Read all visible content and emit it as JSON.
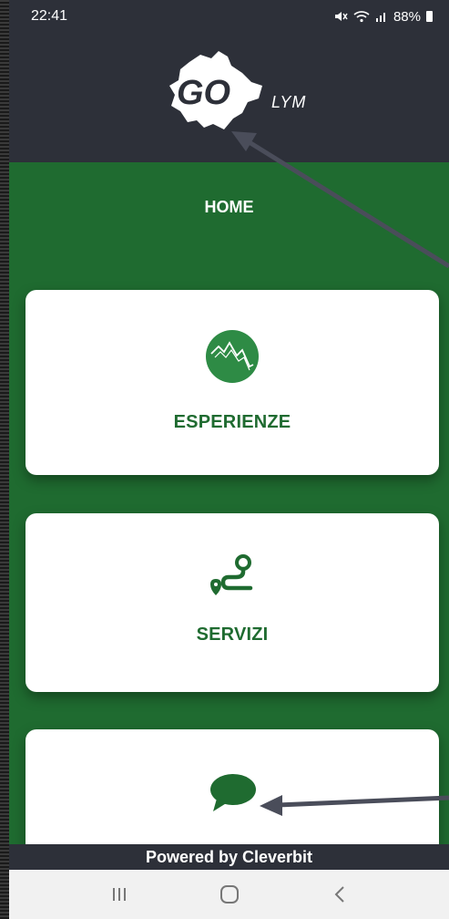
{
  "status_bar": {
    "time": "22:41",
    "battery": "88%",
    "icons": [
      "mute-icon",
      "wifi-icon",
      "signal-icon",
      "battery-icon"
    ]
  },
  "header": {
    "logo_text": "GO",
    "logo_suffix": "LYM"
  },
  "page": {
    "title": "HOME"
  },
  "cards": [
    {
      "label": "ESPERIENZE",
      "icon": "mountain-icon"
    },
    {
      "label": "SERVIZI",
      "icon": "route-icon"
    },
    {
      "label": "",
      "icon": "chat-bubble-icon"
    }
  ],
  "footer": {
    "text": "Powered by Cleverbit"
  },
  "nav_bar": {
    "buttons": [
      "recents-icon",
      "home-icon",
      "back-icon"
    ]
  },
  "colors": {
    "brand_green": "#1f6b30",
    "header_dark": "#2d3039",
    "card_bg": "#ffffff",
    "annotation_arrow": "#4a4d5a"
  }
}
